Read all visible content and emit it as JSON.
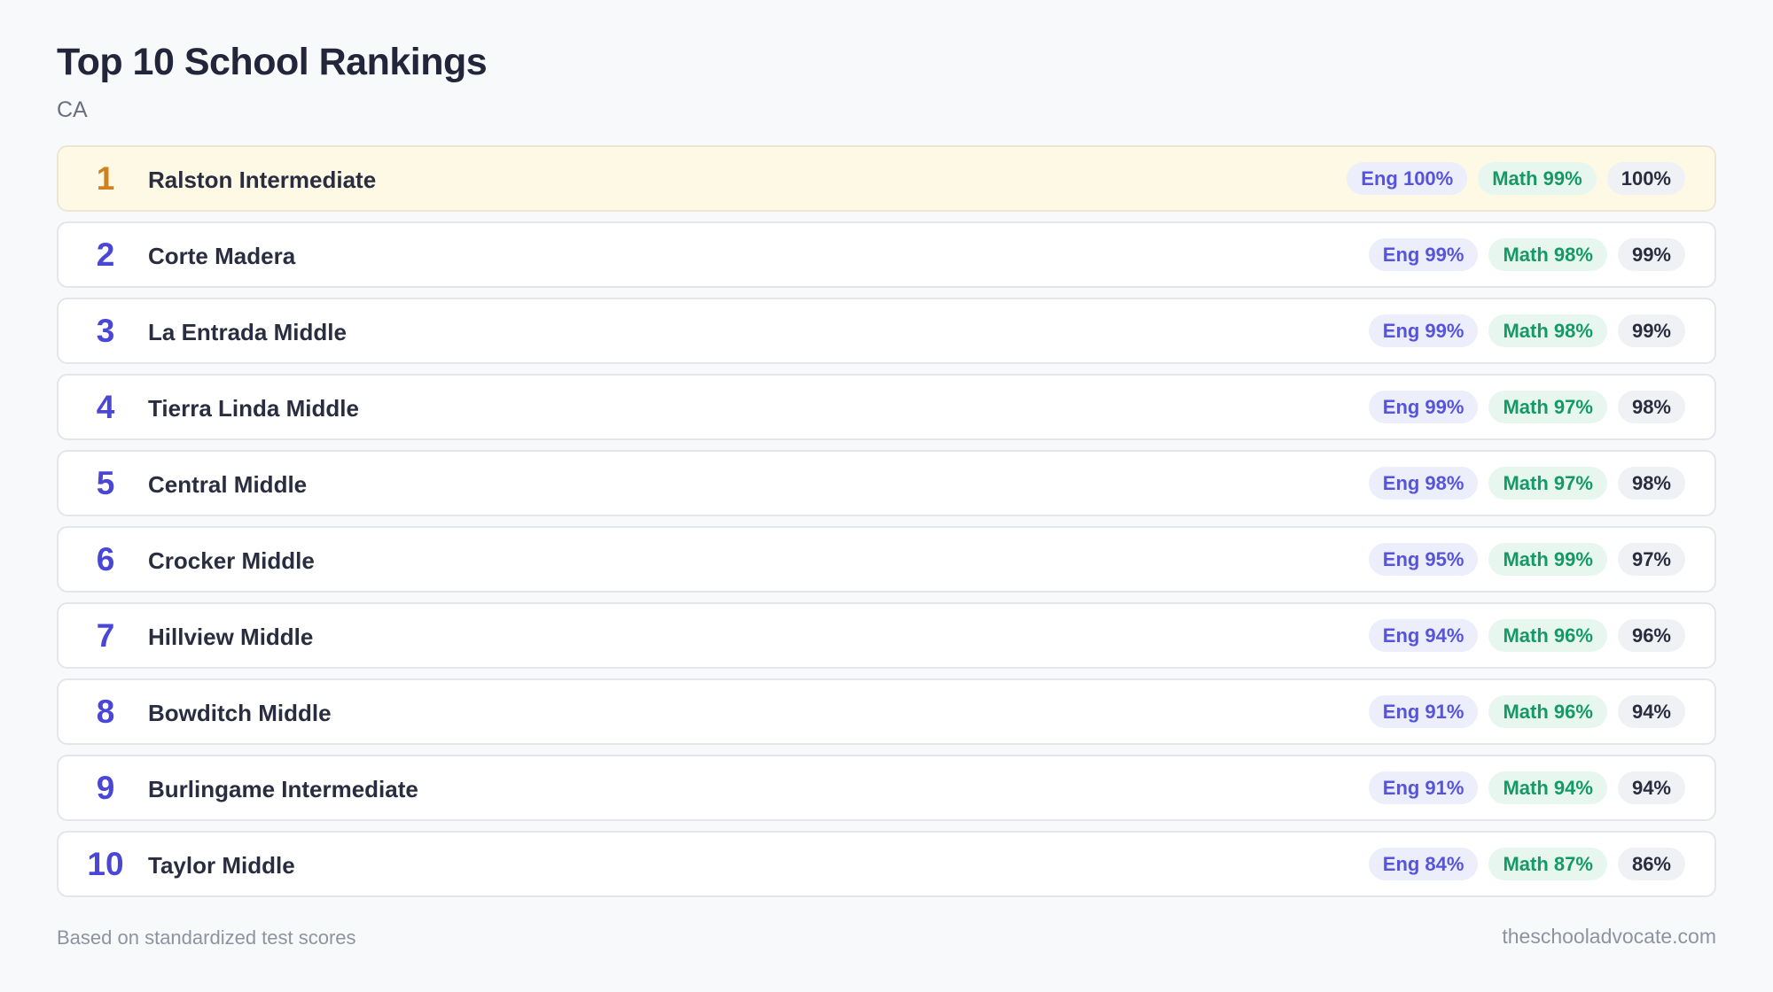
{
  "header": {
    "title": "Top 10 School Rankings",
    "subtitle": "CA"
  },
  "schools": [
    {
      "rank": "1",
      "name": "Ralston Intermediate",
      "eng": "Eng 100%",
      "math": "Math 99%",
      "total": "100%"
    },
    {
      "rank": "2",
      "name": "Corte Madera",
      "eng": "Eng 99%",
      "math": "Math 98%",
      "total": "99%"
    },
    {
      "rank": "3",
      "name": "La Entrada Middle",
      "eng": "Eng 99%",
      "math": "Math 98%",
      "total": "99%"
    },
    {
      "rank": "4",
      "name": "Tierra Linda Middle",
      "eng": "Eng 99%",
      "math": "Math 97%",
      "total": "98%"
    },
    {
      "rank": "5",
      "name": "Central Middle",
      "eng": "Eng 98%",
      "math": "Math 97%",
      "total": "98%"
    },
    {
      "rank": "6",
      "name": "Crocker Middle",
      "eng": "Eng 95%",
      "math": "Math 99%",
      "total": "97%"
    },
    {
      "rank": "7",
      "name": "Hillview Middle",
      "eng": "Eng 94%",
      "math": "Math 96%",
      "total": "96%"
    },
    {
      "rank": "8",
      "name": "Bowditch Middle",
      "eng": "Eng 91%",
      "math": "Math 96%",
      "total": "94%"
    },
    {
      "rank": "9",
      "name": "Burlingame Intermediate",
      "eng": "Eng 91%",
      "math": "Math 94%",
      "total": "94%"
    },
    {
      "rank": "10",
      "name": "Taylor Middle",
      "eng": "Eng 84%",
      "math": "Math 87%",
      "total": "86%"
    }
  ],
  "footer": {
    "note": "Based on standardized test scores",
    "source": "theschooladvocate.com"
  },
  "colors": {
    "top_rank": "#d0811f",
    "rank": "#4a47d6",
    "top_row_background": "#fef9e4",
    "eng_text": "#5654dc",
    "math_text": "#159a67"
  }
}
